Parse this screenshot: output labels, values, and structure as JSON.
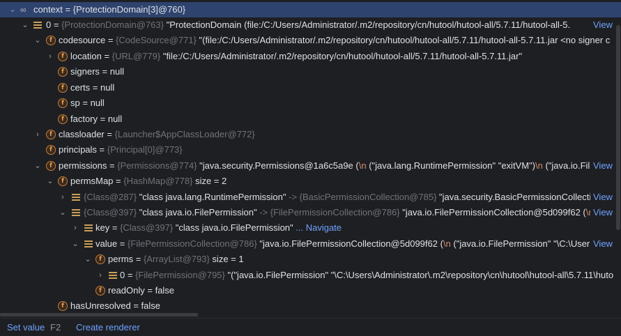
{
  "rows": [
    {
      "name": "context",
      "eq": " = ",
      "value": "{ProtectionDomain[3]@760}"
    },
    {
      "name": "0",
      "eq": " = ",
      "type": "{ProtectionDomain@763}",
      "value": " \"ProtectionDomain  (file:/C:/Users/Administrator/.m2/repository/cn/hutool/hutool-all/5.7.11/hutool-all-5.",
      "view": "View"
    },
    {
      "name": "codesource",
      "eq": " = ",
      "type": "{CodeSource@771}",
      "value": " \"(file:/C:/Users/Administrator/.m2/repository/cn/hutool/hutool-all/5.7.11/hutool-all-5.7.11.jar <no signer c"
    },
    {
      "name": "location",
      "eq": " = ",
      "type": "{URL@779}",
      "value": " \"file:/C:/Users/Administrator/.m2/repository/cn/hutool/hutool-all/5.7.11/hutool-all-5.7.11.jar\""
    },
    {
      "name": "signers",
      "eq": " = ",
      "value": "null"
    },
    {
      "name": "certs",
      "eq": " = ",
      "value": "null"
    },
    {
      "name": "sp",
      "eq": " = ",
      "value": "null"
    },
    {
      "name": "factory",
      "eq": " = ",
      "value": "null"
    },
    {
      "name": "classloader",
      "eq": " = ",
      "type": "{Launcher$AppClassLoader@772}"
    },
    {
      "name": "principals",
      "eq": " = ",
      "type": "{Principal[0]@773}"
    },
    {
      "name": "permissions",
      "eq": " = ",
      "type": "{Permissions@774}",
      "value": " \"java.security.Permissions@1a6c5a9e (",
      "esc": "\\n",
      "value2": " (\"java.lang.RuntimePermission\" \"exitVM\")",
      "esc2": "\\n",
      "value3": " (\"java.io.File",
      "view": "View"
    },
    {
      "name": "permsMap",
      "eq": " = ",
      "type": "{HashMap@778}",
      "value": "  size = 2"
    },
    {
      "type": "{Class@287}",
      "value": " \"class java.lang.RuntimePermission\"",
      "arrow": " -> ",
      "type2": "{BasicPermissionCollection@785}",
      "value2": " \"java.security.BasicPermissionCollectio",
      "view": "View"
    },
    {
      "type": "{Class@397}",
      "value": " \"class java.io.FilePermission\"",
      "arrow": " -> ",
      "type2": "{FilePermissionCollection@786}",
      "value2": " \"java.io.FilePermissionCollection@5d099f62 (",
      "esc": "\\n",
      "value3": "",
      "view": "View"
    },
    {
      "name": "key",
      "eq": " = ",
      "type": "{Class@397}",
      "value": " \"class java.io.FilePermission\"",
      "link": " ... Navigate"
    },
    {
      "name": "value",
      "eq": " = ",
      "type": "{FilePermissionCollection@786}",
      "value": " \"java.io.FilePermissionCollection@5d099f62 (",
      "esc": "\\n",
      "value2": " (\"java.io.FilePermission\" \"\\C:\\User",
      "view": "View"
    },
    {
      "name": "perms",
      "eq": " = ",
      "type": "{ArrayList@793}",
      "value": "  size = 1"
    },
    {
      "name": "0",
      "eq": " = ",
      "type": "{FilePermission@795}",
      "value": " \"(\"java.io.FilePermission\" \"\\C:\\Users\\Administrator\\.m2\\repository\\cn\\hutool\\hutool-all\\5.7.11\\huto"
    },
    {
      "name": "readOnly",
      "eq": " = ",
      "value": "false"
    },
    {
      "name": "hasUnresolved",
      "eq": " = ",
      "value": "false"
    }
  ],
  "bottom": {
    "set_value": "Set value",
    "set_value_key": "F2",
    "create_renderer": "Create renderer"
  },
  "icons": {
    "field": "f",
    "expanded": "chevron-down-icon",
    "collapsed": "chevron-right-icon",
    "watch": "glasses-icon",
    "list": "list-icon"
  },
  "colors": {
    "selected_row": "#2e436e",
    "link": "#6ea2ff",
    "type_gray": "#6f737a",
    "field_icon": "#e69a4c"
  }
}
